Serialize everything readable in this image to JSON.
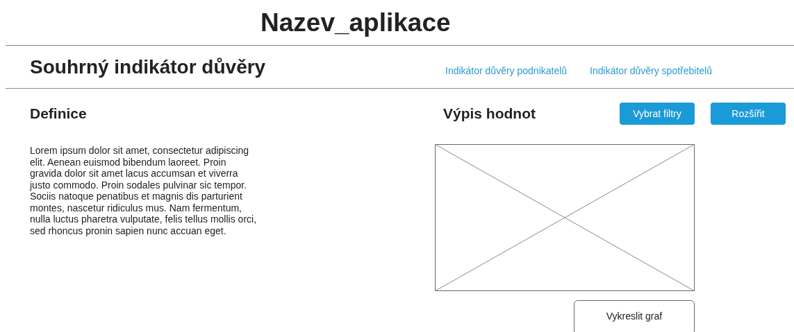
{
  "app_title": "Nazev_aplikace",
  "page_title": "Souhrný indikátor důvěry",
  "nav_links": [
    {
      "label": "Indikátor důvěry podnikatelů"
    },
    {
      "label": "Indikátor důvěry spotřebitelů"
    }
  ],
  "definition": {
    "heading": "Definice",
    "text": "Lorem ipsum dolor sit amet, consectetur adipiscing elit. Aenean euismod bibendum laoreet. Proin gravida dolor sit amet lacus accumsan et viverra justo commodo. Proin sodales pulvinar sic tempor. Sociis natoque penatibus et magnis dis parturient montes, nascetur ridiculus mus. Nam fermentum, nulla luctus pharetra vulputate, felis tellus mollis orci, sed rhoncus pronin sapien nunc accuan eget."
  },
  "values": {
    "heading": "Výpis hodnot",
    "buttons": [
      {
        "label": "Vybrat filtry"
      },
      {
        "label": "Rozšířit"
      }
    ],
    "plot_button": "Vykreslit graf"
  }
}
